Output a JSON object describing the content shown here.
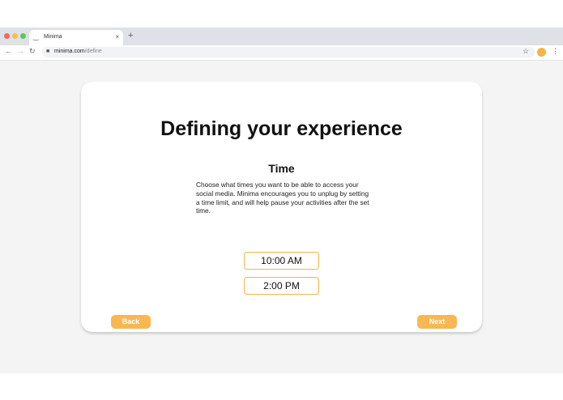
{
  "browser": {
    "tab_title": "Minima",
    "tab_close": "×",
    "new_tab": "+",
    "url_host": "minima.com",
    "url_path": "/define"
  },
  "page": {
    "heading": "Defining your experience",
    "subheading": "Time",
    "description": "Choose what times you want to be able to access your social media. Minima encourages you to unplug by setting a time limit, and will help pause your activities after the set time.",
    "times": [
      "10:00 AM",
      "2:00 PM"
    ],
    "back_label": "Back",
    "next_label": "Next"
  },
  "colors": {
    "accent": "#f9b753",
    "background": "#f4f4f4"
  },
  "icons": [
    "back-arrow-icon",
    "forward-arrow-icon",
    "reload-icon",
    "lock-icon",
    "star-icon",
    "profile-icon",
    "menu-icon"
  ]
}
